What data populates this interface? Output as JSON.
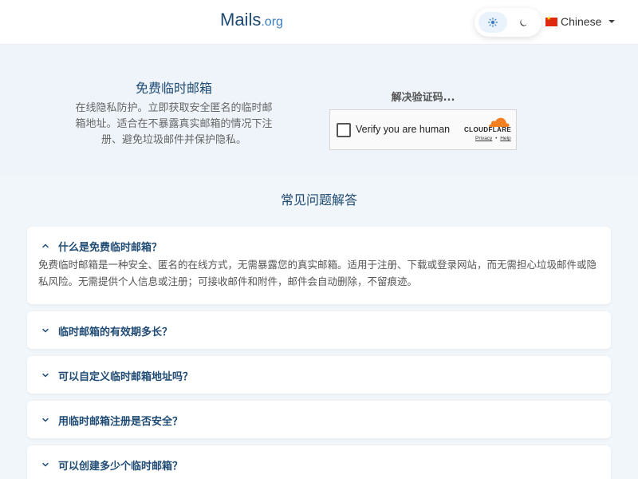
{
  "header": {
    "brand": "Mails",
    "tld": ".org",
    "theme_icons": [
      "sun-icon",
      "moon-icon"
    ],
    "language": "Chinese",
    "language_flag": "china-flag-icon"
  },
  "hero": {
    "title": "免费临时邮箱",
    "description": "在线隐私防护。立即获取安全匿名的临时邮箱地址。适合在不暴露真实邮箱的情况下注册、避免垃圾邮件并保护隐私。",
    "captcha_label": "解决验证码...",
    "captcha": {
      "checkbox_label": "Verify you are human",
      "provider": "CLOUDFLARE",
      "privacy_link": "Privacy",
      "separator": "•",
      "help_link": "Help"
    }
  },
  "faq": {
    "title": "常见问题解答",
    "items": [
      {
        "question": "什么是免费临时邮箱？",
        "answer": "免费临时邮箱是一种安全、匿名的在线方式，无需暴露您的真实邮箱。适用于注册、下载或登录网站，而无需担心垃圾邮件或隐私风险。无需提供个人信息或注册；可接收邮件和附件，邮件会自动删除，不留痕迹。",
        "expanded": true
      },
      {
        "question": "临时邮箱的有效期多长？",
        "expanded": false
      },
      {
        "question": "可以自定义临时邮箱地址吗？",
        "expanded": false
      },
      {
        "question": "用临时邮箱注册是否安全？",
        "expanded": false
      },
      {
        "question": "可以创建多少个临时邮箱？",
        "expanded": false
      }
    ]
  },
  "colors": {
    "accent": "#1e4a73",
    "link": "#3b7dbd",
    "cloudflare_orange": "#f38020",
    "flag_red": "#de2910"
  }
}
